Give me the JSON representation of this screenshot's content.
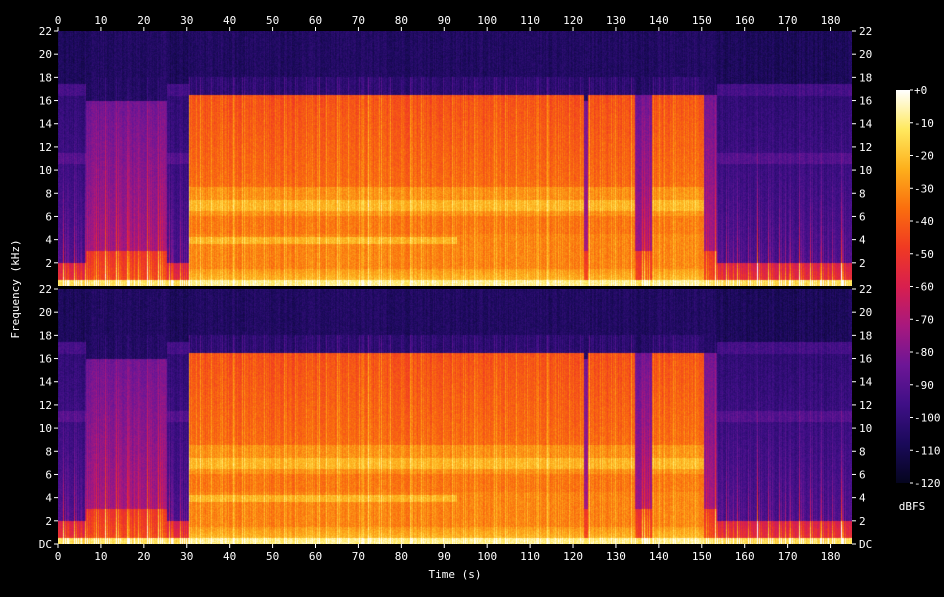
{
  "chart_data": {
    "type": "heatmap",
    "subtype": "spectrogram",
    "xlabel": "Time (s)",
    "ylabel": "Frequency (kHz)",
    "xlim": [
      0,
      185
    ],
    "ylim": [
      0,
      22
    ],
    "x_ticks": [
      "0",
      "10",
      "20",
      "30",
      "40",
      "50",
      "60",
      "70",
      "80",
      "90",
      "100",
      "110",
      "120",
      "130",
      "140",
      "150",
      "160",
      "170",
      "180"
    ],
    "y_ticks_channel_1": [
      "2",
      "4",
      "6",
      "8",
      "10",
      "12",
      "14",
      "16",
      "18",
      "20",
      "22"
    ],
    "y_ticks_channel_2": [
      "DC",
      "2",
      "4",
      "6",
      "8",
      "10",
      "12",
      "14",
      "16",
      "18",
      "20",
      "22"
    ],
    "channels": 2,
    "colorbar": {
      "label": "dBFS",
      "ticks": [
        "+0",
        "-10",
        "-20",
        "-30",
        "-40",
        "-50",
        "-60",
        "-70",
        "-80",
        "-90",
        "-100",
        "-110",
        "-120"
      ],
      "range": [
        -120,
        0
      ],
      "colors": [
        "#05051e",
        "#1a0a5a",
        "#3f0f86",
        "#6d1696",
        "#a8187e",
        "#d81f4e",
        "#f03a22",
        "#fa6f0e",
        "#fdb01c",
        "#ffe95f",
        "#ffffff"
      ]
    },
    "segments": [
      {
        "start": 0,
        "end": 6.5,
        "level": "quiet",
        "cutoff_khz": 17
      },
      {
        "start": 6.5,
        "end": 25.5,
        "level": "medium",
        "cutoff_khz": 16
      },
      {
        "start": 25.5,
        "end": 30.5,
        "level": "quiet",
        "cutoff_khz": 17
      },
      {
        "start": 30.5,
        "end": 122.5,
        "level": "loud",
        "cutoff_khz": 16.5
      },
      {
        "start": 122.5,
        "end": 123.5,
        "level": "medium",
        "cutoff_khz": 16
      },
      {
        "start": 123.5,
        "end": 134.5,
        "level": "loud",
        "cutoff_khz": 16.5
      },
      {
        "start": 134.5,
        "end": 138.5,
        "level": "medium",
        "cutoff_khz": 16.5
      },
      {
        "start": 138.5,
        "end": 150.5,
        "level": "loud",
        "cutoff_khz": 16.5
      },
      {
        "start": 150.5,
        "end": 153.5,
        "level": "medium",
        "cutoff_khz": 16.5
      },
      {
        "start": 153.5,
        "end": 185,
        "level": "quiet",
        "cutoff_khz": 17
      }
    ]
  }
}
